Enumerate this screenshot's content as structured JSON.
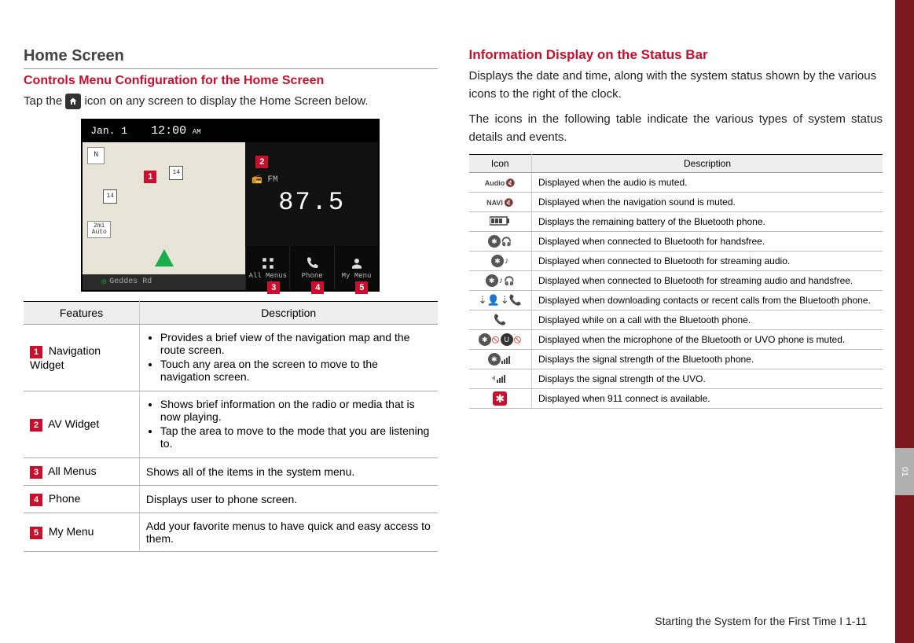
{
  "left": {
    "section_title": "Home Screen",
    "sub_title": "Controls Menu Configuration for the Home Screen",
    "intro_before": "Tap the ",
    "intro_after": " icon on any screen to display the Home Screen below.",
    "home_icon_name": "home"
  },
  "screenshot": {
    "date": "Jan. 1",
    "time": "12:00",
    "ampm": "AM",
    "compass": "N",
    "auto_top": "2mi",
    "auto_bottom": "Auto",
    "shield1": "14",
    "shield2": "14",
    "fm_label": "📻 FM",
    "freq": "87.5",
    "road": "Geddes Rd",
    "btns": [
      {
        "label": "All Menus",
        "icon": "grid"
      },
      {
        "label": "Phone",
        "icon": "phone"
      },
      {
        "label": "My Menu",
        "icon": "person"
      }
    ],
    "badges": [
      "1",
      "2",
      "3",
      "4",
      "5"
    ]
  },
  "features_table": {
    "head_feature": "Features",
    "head_desc": "Description",
    "rows": [
      {
        "num": "1",
        "name": "Navigation Widget",
        "bullets": [
          "Provides a brief view of the navigation map and the route screen.",
          "Touch any area on the screen to move to the navigation screen."
        ]
      },
      {
        "num": "2",
        "name": "AV Widget",
        "bullets": [
          "Shows brief information on the radio or media that is now playing.",
          "Tap the area to move to the mode that you are listening to."
        ]
      },
      {
        "num": "3",
        "name": "All Menus",
        "text": "Shows all of the items in the system menu."
      },
      {
        "num": "4",
        "name": "Phone",
        "text": "Displays user to phone screen."
      },
      {
        "num": "5",
        "name": "My Menu",
        "text": "Add your favorite menus to have quick and easy access to them."
      }
    ]
  },
  "right": {
    "title": "Information Display on the Status Bar",
    "p1": "Displays the date and time, along with the system status shown by the various icons to the right of the clock.",
    "p2": "The icons in the following table indicate the various types of system status details and events."
  },
  "icons_table": {
    "head_icon": "Icon",
    "head_desc": "Description",
    "rows": [
      {
        "icon_label": "Audio-mute",
        "desc": "Displayed when the audio is muted."
      },
      {
        "icon_label": "NAVI-mute",
        "desc": "Displayed when the navigation sound is muted."
      },
      {
        "icon_label": "battery",
        "desc": "Displays the remaining battery of the Bluetooth phone."
      },
      {
        "icon_label": "bt-handsfree",
        "desc": "Displayed when connected to Bluetooth for handsfree."
      },
      {
        "icon_label": "bt-audio",
        "desc": "Displayed when connected to Bluetooth for streaming audio."
      },
      {
        "icon_label": "bt-audio-hf",
        "desc": "Displayed when connected to Bluetooth for streaming audio and handsfree."
      },
      {
        "icon_label": "download",
        "desc": "Displayed when downloading contacts or recent calls from the Bluetooth phone."
      },
      {
        "icon_label": "on-call",
        "desc": "Displayed while on a call with the Bluetooth phone."
      },
      {
        "icon_label": "mic-mute",
        "desc": "Displayed when the microphone of the Bluetooth or UVO phone is muted."
      },
      {
        "icon_label": "bt-signal",
        "desc": "Displays the signal strength of the Bluetooth phone."
      },
      {
        "icon_label": "uvo-signal",
        "desc": "Displays the signal strength of the UVO."
      },
      {
        "icon_label": "911",
        "desc": "Displayed when 911 connect is available."
      }
    ]
  },
  "footer": "Starting the System for the First Time I 1-11",
  "side_tab": "01"
}
